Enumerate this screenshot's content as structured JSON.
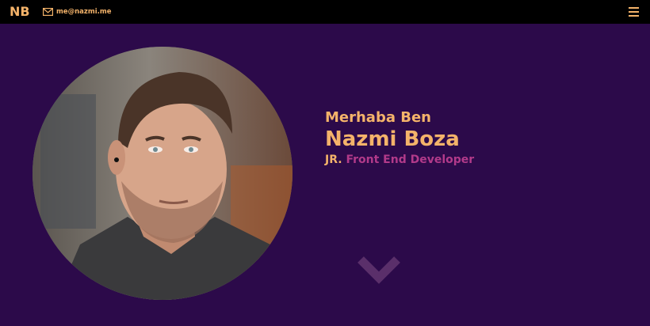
{
  "header": {
    "logo": "NB",
    "email": "me@nazmi.me",
    "email_icon": "envelope-icon",
    "menu_icon": "hamburger-menu-icon"
  },
  "hero": {
    "greeting": "Merhaba Ben",
    "name": "Nazmi Boza",
    "role_prefix": "JR.",
    "role_title": "Front End Developer",
    "scroll_icon": "chevron-down-icon"
  },
  "colors": {
    "background": "#2c0a4a",
    "topbar": "#000000",
    "accent": "#f4b36a",
    "role_highlight": "#b23a8a",
    "chevron": "#5a2f6a"
  }
}
